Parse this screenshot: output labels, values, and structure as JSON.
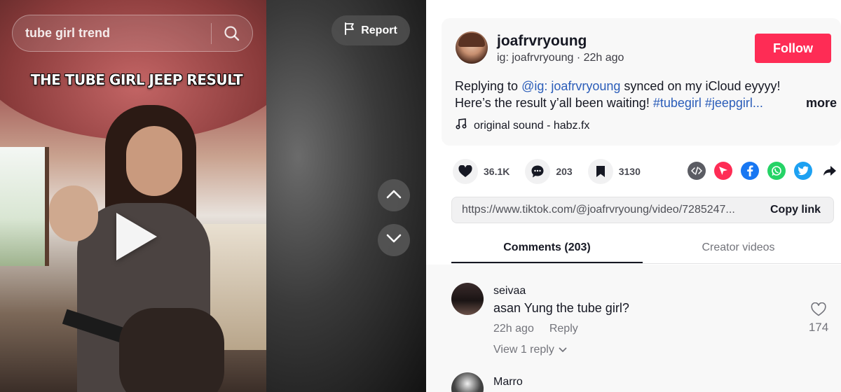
{
  "search": {
    "query": "tube girl trend"
  },
  "video": {
    "caption": "THE TUBE GIRL JEEP RESULT",
    "report_label": "Report"
  },
  "author": {
    "name": "joafrvryoung",
    "subtitle": "ig: joafrvryoung · 22h ago",
    "follow_label": "Follow",
    "description": {
      "prefix": "Replying to ",
      "mention": "@ig: joafrvryoung",
      "line1_rest": " synced on my iCloud eyyyy!",
      "line2": "Here’s the result y’all been waiting! ",
      "hashtags": "#tubegirl #jeepgirl...",
      "more_label": "more"
    },
    "sound": "original sound - habz.fx"
  },
  "actions": {
    "likes": "36.1K",
    "comments": "203",
    "saves": "3130"
  },
  "share_icons": [
    "embed-icon",
    "send-icon",
    "facebook-icon",
    "whatsapp-icon",
    "twitter-icon",
    "share-arrow-icon"
  ],
  "colors": {
    "follow": "#fe2c55",
    "link": "#2b5db9",
    "facebook": "#1877f2",
    "whatsapp": "#25d366",
    "twitter": "#1da1f2",
    "send": "#fe2c55"
  },
  "link_box": {
    "url": "https://www.tiktok.com/@joafrvryoung/video/7285247...",
    "copy_label": "Copy link"
  },
  "tabs": [
    {
      "label": "Comments (203)",
      "active": true
    },
    {
      "label": "Creator videos",
      "active": false
    }
  ],
  "comments": [
    {
      "user": "seivaa",
      "text": "asan Yung the tube girl?",
      "time": "22h ago",
      "reply_label": "Reply",
      "likes": "174",
      "view_replies": "View 1 reply"
    },
    {
      "user": "Marro"
    }
  ]
}
